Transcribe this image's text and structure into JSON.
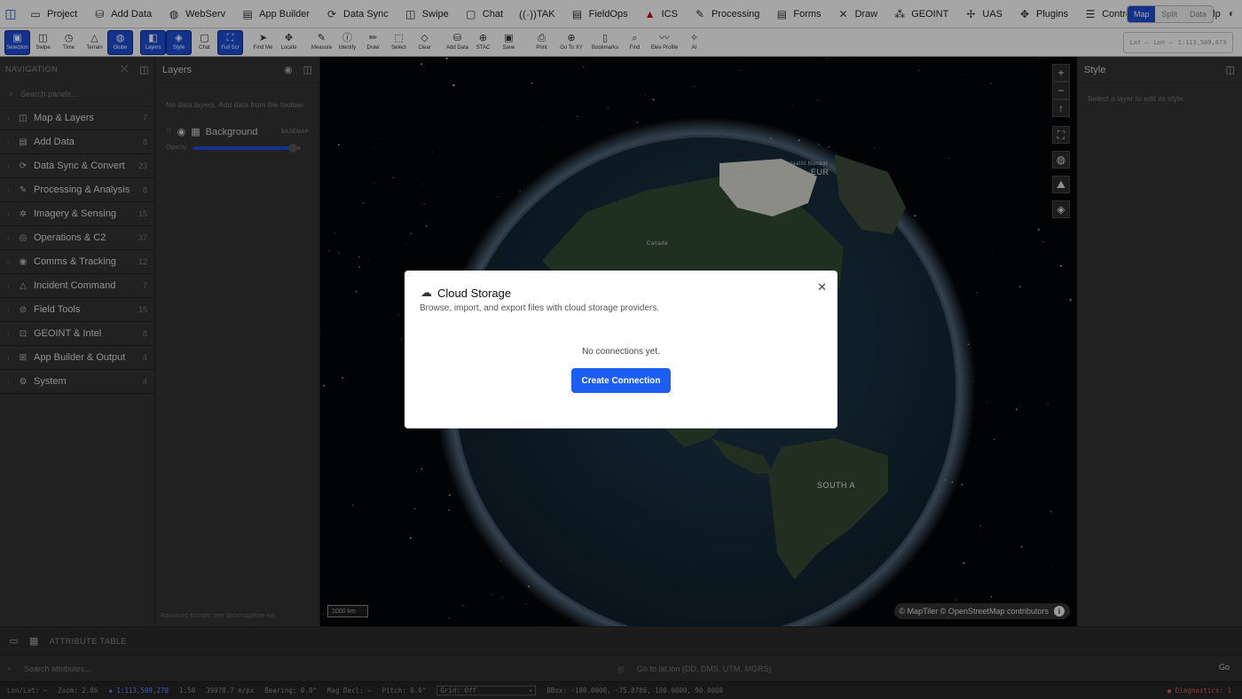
{
  "menu": {
    "items": [
      {
        "icon": "folder-icon",
        "glyph": "▭",
        "label": "Project"
      },
      {
        "icon": "database-icon",
        "glyph": "⛁",
        "label": "Add Data"
      },
      {
        "icon": "globe-icon",
        "glyph": "◍",
        "label": "WebServ"
      },
      {
        "icon": "document-icon",
        "glyph": "▤",
        "label": "App Builder"
      },
      {
        "icon": "sync-icon",
        "glyph": "⟳",
        "label": "Data Sync"
      },
      {
        "icon": "swipe-icon",
        "glyph": "◫",
        "label": "Swipe"
      },
      {
        "icon": "chat-icon",
        "glyph": "▢",
        "label": "Chat"
      },
      {
        "icon": "radio-icon",
        "glyph": "((·))",
        "label": "TAK"
      },
      {
        "icon": "clipboard-icon",
        "glyph": "▤",
        "label": "FieldOps"
      },
      {
        "icon": "ics-icon",
        "glyph": "▲",
        "label": "ICS"
      },
      {
        "icon": "pen-icon",
        "glyph": "✎",
        "label": "Processing"
      },
      {
        "icon": "form-icon",
        "glyph": "▤",
        "label": "Forms"
      },
      {
        "icon": "draw-icon",
        "glyph": "✕",
        "label": "Draw"
      },
      {
        "icon": "geoint-icon",
        "glyph": "⁂",
        "label": "GEOINT"
      },
      {
        "icon": "drone-icon",
        "glyph": "✢",
        "label": "UAS"
      },
      {
        "icon": "puzzle-icon",
        "glyph": "✥",
        "label": "Plugins"
      },
      {
        "icon": "controls-icon",
        "glyph": "☰",
        "label": "Controls"
      },
      {
        "icon": "gear-icon",
        "glyph": "⚙",
        "label": ""
      },
      {
        "icon": "help-icon",
        "glyph": "?",
        "label": "Help"
      }
    ],
    "view_toggle": [
      "Map",
      "Split",
      "Data"
    ],
    "view_active": "Map"
  },
  "toolbar": {
    "tools": [
      {
        "name": "selection",
        "glyph": "▣",
        "label": "Selection",
        "active": true
      },
      {
        "name": "swipe",
        "glyph": "◫",
        "label": "Swipe",
        "active": false
      },
      {
        "name": "time",
        "glyph": "◷",
        "label": "Time",
        "active": false
      },
      {
        "name": "terrain",
        "glyph": "△",
        "label": "Terrain",
        "active": false
      },
      {
        "name": "globe",
        "glyph": "◍",
        "label": "Globe",
        "active": true
      },
      {
        "name": "sep",
        "glyph": "",
        "label": "",
        "active": false
      },
      {
        "name": "layers",
        "glyph": "◧",
        "label": "Layers",
        "active": true
      },
      {
        "name": "style",
        "glyph": "◈",
        "label": "Style",
        "active": true
      },
      {
        "name": "chat",
        "glyph": "▢",
        "label": "Chat",
        "active": false
      },
      {
        "name": "full-scr",
        "glyph": "⛶",
        "label": "Full Scr",
        "active": true
      },
      {
        "name": "sep",
        "glyph": "",
        "label": "",
        "active": false
      },
      {
        "name": "find-me",
        "glyph": "➤",
        "label": "Find Me",
        "active": false
      },
      {
        "name": "locate",
        "glyph": "✥",
        "label": "Locate",
        "active": false
      },
      {
        "name": "sep",
        "glyph": "",
        "label": "",
        "active": false
      },
      {
        "name": "measure",
        "glyph": "✎",
        "label": "Measure",
        "active": false
      },
      {
        "name": "identify",
        "glyph": "ⓘ",
        "label": "Identify",
        "active": false
      },
      {
        "name": "draw",
        "glyph": "✏",
        "label": "Draw",
        "active": false
      },
      {
        "name": "select",
        "glyph": "⬚",
        "label": "Select",
        "active": false
      },
      {
        "name": "clear",
        "glyph": "◇",
        "label": "Clear",
        "active": false
      },
      {
        "name": "sep",
        "glyph": "",
        "label": "",
        "active": false
      },
      {
        "name": "add-data",
        "glyph": "⛁",
        "label": "Add Data",
        "active": false
      },
      {
        "name": "stac",
        "glyph": "⊕",
        "label": "STAC",
        "active": false
      },
      {
        "name": "save",
        "glyph": "▣",
        "label": "Save",
        "active": false
      },
      {
        "name": "sep",
        "glyph": "",
        "label": "",
        "active": false
      },
      {
        "name": "print",
        "glyph": "⎙",
        "label": "Print",
        "active": false
      },
      {
        "name": "goto-xy",
        "glyph": "⊕",
        "label": "Go To XY",
        "active": false
      },
      {
        "name": "bookmarks",
        "glyph": "▯",
        "label": "Bookmarks",
        "active": false
      },
      {
        "name": "find",
        "glyph": "⌕",
        "label": "Find",
        "active": false
      },
      {
        "name": "elev-profile",
        "glyph": "〰",
        "label": "Elev Profile",
        "active": false
      },
      {
        "name": "ai",
        "glyph": "✧",
        "label": "AI",
        "active": false
      }
    ],
    "coord_readout": [
      "Lat —",
      "Lon —",
      "1:113,509,673"
    ]
  },
  "navigation": {
    "header": "NAVIGATION",
    "search_placeholder": "Search panels...",
    "items": [
      {
        "label": "Map & Layers",
        "icon": "map-icon",
        "glyph": "◫",
        "count": "7"
      },
      {
        "label": "Add Data",
        "icon": "database-icon",
        "glyph": "▤",
        "count": "8"
      },
      {
        "label": "Data Sync & Convert",
        "icon": "sync-icon",
        "glyph": "⟳",
        "count": "23"
      },
      {
        "label": "Processing & Analysis",
        "icon": "pen-icon",
        "glyph": "✎",
        "count": "8"
      },
      {
        "label": "Imagery & Sensing",
        "icon": "satellite-icon",
        "glyph": "✲",
        "count": "15"
      },
      {
        "label": "Operations & C2",
        "icon": "target-icon",
        "glyph": "◎",
        "count": "37"
      },
      {
        "label": "Comms & Tracking",
        "icon": "radio-icon",
        "glyph": "◉",
        "count": "12"
      },
      {
        "label": "Incident Command",
        "icon": "warning-icon",
        "glyph": "△",
        "count": "7"
      },
      {
        "label": "Field Tools",
        "icon": "compass-icon",
        "glyph": "⊘",
        "count": "15"
      },
      {
        "label": "GEOINT & Intel",
        "icon": "geoint-icon",
        "glyph": "⊡",
        "count": "8"
      },
      {
        "label": "App Builder & Output",
        "icon": "grid-icon",
        "glyph": "⊞",
        "count": "4"
      },
      {
        "label": "System",
        "icon": "gear-icon",
        "glyph": "⚙",
        "count": "4"
      }
    ]
  },
  "layers": {
    "title": "Layers",
    "empty_text": "No data layers. Add data from the toolbar.",
    "layer_name": "Background",
    "layer_tag": "BASEMAP",
    "opacity_label": "Opacity",
    "opacity_value": 0.93,
    "footer": "Advanced formats: see docs/maplibre-ext"
  },
  "map": {
    "scale_text": "1000 km",
    "attribution": "© MapTiler © OpenStreetMap contributors",
    "labels": {
      "eur": "EUR",
      "south_america": "SOUTH A",
      "canada": "Canada",
      "nunavut": "Nunavut",
      "kalaallit": "Kalaallit Nunaat"
    }
  },
  "style_panel": {
    "title": "Style",
    "empty_text": "Select a layer to edit its style."
  },
  "modal": {
    "title": "Cloud Storage",
    "description": "Browse, import, and export files with cloud storage providers.",
    "empty_text": "No connections yet.",
    "button_label": "Create Connection"
  },
  "attribute_table": {
    "label": "ATTRIBUTE TABLE"
  },
  "search_bar": {
    "placeholder": "Search attributes...",
    "goto_placeholder": "Go to lat,lon (DD, DMS, UTM, MGRS)",
    "go_label": "Go"
  },
  "status": {
    "coords": "Lon/Lat: —",
    "zoom": "Zoom: 2.86",
    "scale": "1:113,509,278",
    "res": "1:50",
    "mpp": "39978.7 m/px",
    "bearing": "Bearing: 0.0°",
    "mag_decl": "Mag Decl: —",
    "pitch": "Pitch: 0.0°",
    "grid": "Grid: Off",
    "bbox": "BBox: -180.0000, -75.8786, 180.0000, 90.0000",
    "diagnostics": "Diagnostics: 1"
  },
  "colors": {
    "accent": "#1d4ed8",
    "button": "#1d5ef2",
    "diagnostic": "#e05a5a"
  }
}
